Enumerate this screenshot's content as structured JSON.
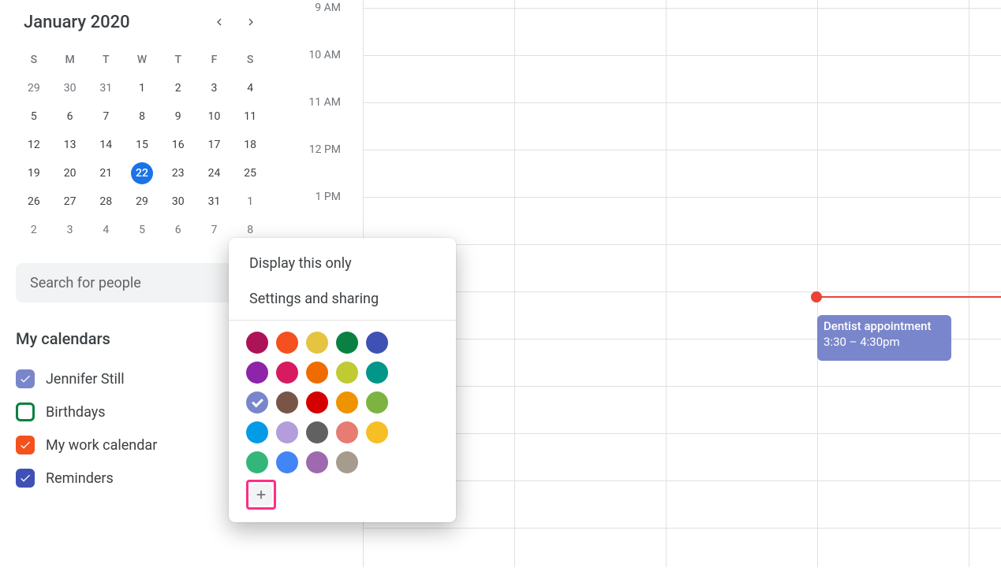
{
  "mini_calendar": {
    "title": "January 2020",
    "dows": [
      "S",
      "M",
      "T",
      "W",
      "T",
      "F",
      "S"
    ],
    "weeks": [
      [
        {
          "n": "29",
          "out": true
        },
        {
          "n": "30",
          "out": true
        },
        {
          "n": "31",
          "out": true
        },
        {
          "n": "1"
        },
        {
          "n": "2"
        },
        {
          "n": "3"
        },
        {
          "n": "4"
        }
      ],
      [
        {
          "n": "5"
        },
        {
          "n": "6"
        },
        {
          "n": "7"
        },
        {
          "n": "8"
        },
        {
          "n": "9"
        },
        {
          "n": "10"
        },
        {
          "n": "11"
        }
      ],
      [
        {
          "n": "12"
        },
        {
          "n": "13"
        },
        {
          "n": "14"
        },
        {
          "n": "15"
        },
        {
          "n": "16"
        },
        {
          "n": "17"
        },
        {
          "n": "18"
        }
      ],
      [
        {
          "n": "19"
        },
        {
          "n": "20"
        },
        {
          "n": "21"
        },
        {
          "n": "22",
          "today": true
        },
        {
          "n": "23"
        },
        {
          "n": "24"
        },
        {
          "n": "25"
        }
      ],
      [
        {
          "n": "26"
        },
        {
          "n": "27"
        },
        {
          "n": "28"
        },
        {
          "n": "29"
        },
        {
          "n": "30"
        },
        {
          "n": "31"
        },
        {
          "n": "1",
          "out": true
        }
      ],
      [
        {
          "n": "2",
          "out": true
        },
        {
          "n": "3",
          "out": true
        },
        {
          "n": "4",
          "out": true
        },
        {
          "n": "5",
          "out": true
        },
        {
          "n": "6",
          "out": true
        },
        {
          "n": "7",
          "out": true
        },
        {
          "n": "8",
          "out": true
        }
      ]
    ]
  },
  "search": {
    "placeholder": "Search for people"
  },
  "my_calendars": {
    "title": "My calendars",
    "items": [
      {
        "label": "Jennifer Still",
        "color": "#7986cb",
        "checked": true
      },
      {
        "label": "Birthdays",
        "color": "#0b8043",
        "checked": false
      },
      {
        "label": "My work calendar",
        "color": "#f4511e",
        "checked": true
      },
      {
        "label": "Reminders",
        "color": "#3f51b5",
        "checked": true
      }
    ]
  },
  "time_labels": [
    "9 AM",
    "10 AM",
    "11 AM",
    "12 PM",
    "1 PM"
  ],
  "popover": {
    "display_only": "Display this only",
    "settings": "Settings and sharing",
    "colors": [
      "#ad1457",
      "#f4511e",
      "#e4c441",
      "#0b8043",
      "#3f51b5",
      "#8e24aa",
      "#d81b60",
      "#ef6c00",
      "#c0ca33",
      "#009688",
      "#7986cb",
      "#795548",
      "#d50000",
      "#f09300",
      "#7cb342",
      "#039be5",
      "#b39ddb",
      "#616161",
      "#e67c73",
      "#f6bf26",
      "#33b679",
      "#4285f4",
      "#9e69af",
      "#a79b8e"
    ],
    "selected_index": 10
  },
  "event": {
    "title": "Dentist appointment",
    "time": "3:30 – 4:30pm"
  }
}
